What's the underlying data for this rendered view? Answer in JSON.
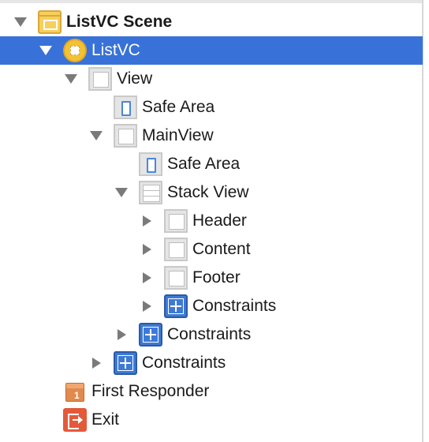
{
  "outline": {
    "items": [
      {
        "label": "ListVC Scene",
        "icon": "scene-icon",
        "level": 0,
        "disclosure": "expanded",
        "bold": true,
        "selected": false
      },
      {
        "label": "ListVC",
        "icon": "view-controller-icon",
        "level": 1,
        "disclosure": "expanded",
        "bold": false,
        "selected": true
      },
      {
        "label": "View",
        "icon": "view-icon",
        "level": 2,
        "disclosure": "expanded",
        "bold": false,
        "selected": false
      },
      {
        "label": "Safe Area",
        "icon": "safe-area-icon",
        "level": 3,
        "disclosure": "none",
        "bold": false,
        "selected": false
      },
      {
        "label": "MainView",
        "icon": "view-icon",
        "level": 3,
        "disclosure": "expanded",
        "bold": false,
        "selected": false
      },
      {
        "label": "Safe Area",
        "icon": "safe-area-icon",
        "level": 4,
        "disclosure": "none",
        "bold": false,
        "selected": false
      },
      {
        "label": "Stack View",
        "icon": "stack-view-icon",
        "level": 4,
        "disclosure": "expanded",
        "bold": false,
        "selected": false
      },
      {
        "label": "Header",
        "icon": "view-icon",
        "level": 5,
        "disclosure": "collapsed",
        "bold": false,
        "selected": false
      },
      {
        "label": "Content",
        "icon": "view-icon",
        "level": 5,
        "disclosure": "collapsed",
        "bold": false,
        "selected": false
      },
      {
        "label": "Footer",
        "icon": "view-icon",
        "level": 5,
        "disclosure": "collapsed",
        "bold": false,
        "selected": false
      },
      {
        "label": "Constraints",
        "icon": "constraints-icon",
        "level": 5,
        "disclosure": "collapsed",
        "bold": false,
        "selected": false
      },
      {
        "label": "Constraints",
        "icon": "constraints-icon",
        "level": 4,
        "disclosure": "collapsed",
        "bold": false,
        "selected": false
      },
      {
        "label": "Constraints",
        "icon": "constraints-icon",
        "level": 3,
        "disclosure": "collapsed",
        "bold": false,
        "selected": false
      },
      {
        "label": "First Responder",
        "icon": "first-responder-icon",
        "level": 1,
        "disclosure": "none",
        "bold": false,
        "selected": false
      },
      {
        "label": "Exit",
        "icon": "exit-icon",
        "level": 1,
        "disclosure": "none",
        "bold": false,
        "selected": false
      }
    ]
  },
  "colors": {
    "selection": "#3872d8",
    "text": "#1a1a1a"
  }
}
